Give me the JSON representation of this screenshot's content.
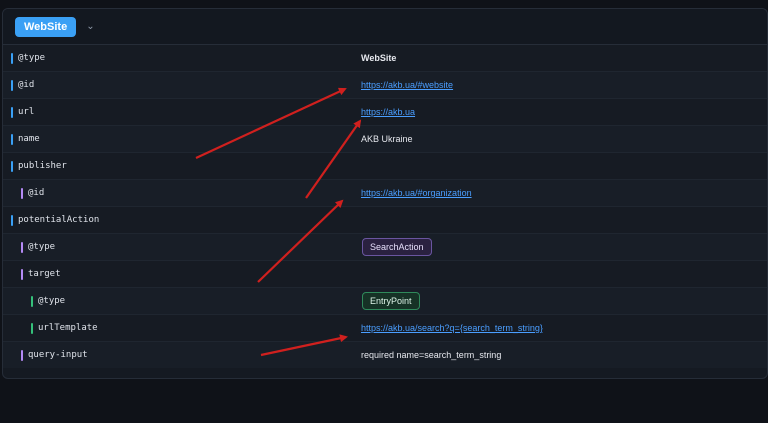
{
  "header": {
    "type_label": "WebSite",
    "toggle_icon": "chevron-down-icon"
  },
  "rows": [
    {
      "key": "@type",
      "value": "WebSite"
    },
    {
      "key": "@id",
      "value": "https://akb.ua/#website"
    },
    {
      "key": "url",
      "value": "https://akb.ua"
    },
    {
      "key": "name",
      "value": "AKB Ukraine"
    },
    {
      "key": "publisher",
      "value": ""
    },
    {
      "key": "@id",
      "value": "https://akb.ua/#organization"
    },
    {
      "key": "potentialAction",
      "value": ""
    },
    {
      "key": "@type",
      "value": "SearchAction"
    },
    {
      "key": "target",
      "value": ""
    },
    {
      "key": "@type",
      "value": "EntryPoint"
    },
    {
      "key": "urlTemplate",
      "value": "https://akb.ua/search?q={search_term_string}"
    },
    {
      "key": "query-input",
      "value": "required name=search_term_string"
    }
  ],
  "colors": {
    "accent": "#3aa0f5",
    "level1_bar": "#3aa0f5",
    "level2_bar": "#b48af5",
    "level3_bar": "#35c07a",
    "link": "#4a9eff",
    "arrow": "#d0201e"
  }
}
